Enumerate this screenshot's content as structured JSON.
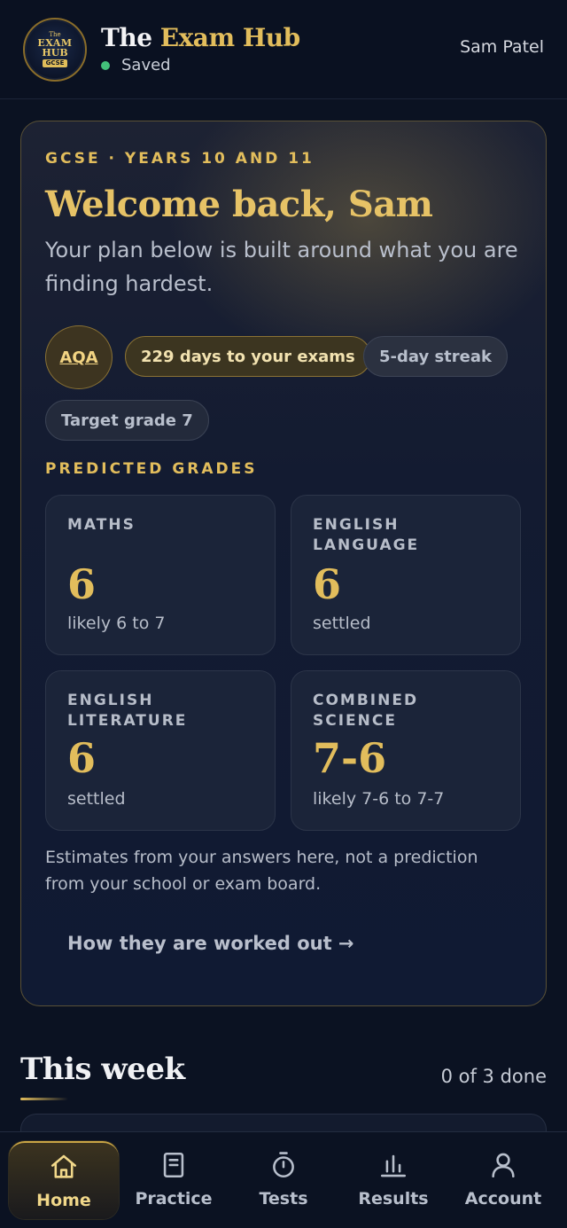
{
  "header": {
    "logo": {
      "top": "The",
      "main": "EXAM",
      "main2": "HUB",
      "tag": "GCSE"
    },
    "title_plain": "The ",
    "title_gold": "Exam Hub",
    "status": "Saved",
    "user": "Sam Patel"
  },
  "hero": {
    "eyebrow": "GCSE · YEARS 10 AND 11",
    "welcome": "Welcome back, Sam",
    "intro": "Your plan below is built around what you are finding hardest.",
    "chips": {
      "board": "AQA",
      "days": "229 days to your exams",
      "streak": "5-day streak",
      "target": "Target grade 7"
    },
    "predicted_label": "PREDICTED GRADES",
    "grades": [
      {
        "subject": "MATHS",
        "grade": "6",
        "note": "likely 6 to 7"
      },
      {
        "subject": "ENGLISH LANGUAGE",
        "grade": "6",
        "note": "settled"
      },
      {
        "subject": "ENGLISH LITERATURE",
        "grade": "6",
        "note": "settled"
      },
      {
        "subject": "COMBINED SCIENCE",
        "grade": "7-6",
        "note": "likely 7-6 to 7-7"
      }
    ],
    "estimate_note": "Estimates from your answers here, not a prediction from your school or exam board.",
    "how_link": "How they are worked out →"
  },
  "week": {
    "title": "This week",
    "progress": "0 of 3 done"
  },
  "nav": {
    "items": [
      {
        "label": "Home",
        "icon": "home-icon",
        "active": true
      },
      {
        "label": "Practice",
        "icon": "book-icon",
        "active": false
      },
      {
        "label": "Tests",
        "icon": "timer-icon",
        "active": false
      },
      {
        "label": "Results",
        "icon": "bar-chart-icon",
        "active": false
      },
      {
        "label": "Account",
        "icon": "person-icon",
        "active": false
      }
    ]
  },
  "colors": {
    "accent_gold": "#e2bd5c",
    "saved_green": "#43c07a",
    "background": "#0b1222"
  }
}
